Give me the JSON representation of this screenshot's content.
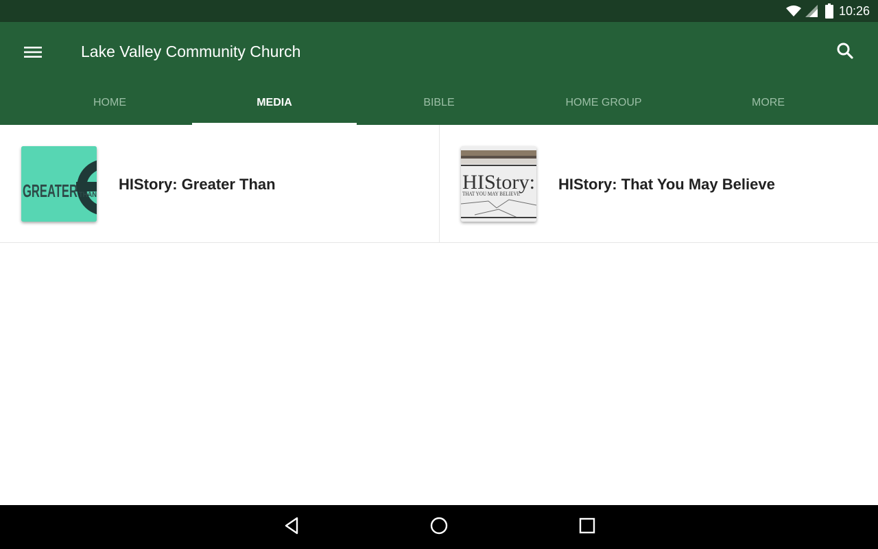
{
  "status_bar": {
    "time": "10:26",
    "icons": [
      "wifi-icon",
      "cell-signal-icon",
      "battery-icon"
    ]
  },
  "app_bar": {
    "title": "Lake Valley Community Church",
    "menu_icon": "hamburger-menu-icon",
    "search_icon": "search-icon"
  },
  "tabs": [
    {
      "label": "HOME",
      "active": false
    },
    {
      "label": "MEDIA",
      "active": true
    },
    {
      "label": "BIBLE",
      "active": false
    },
    {
      "label": "HOME GROUP",
      "active": false
    },
    {
      "label": "MORE",
      "active": false
    }
  ],
  "media_items": [
    {
      "title": "HIStory: Greater Than",
      "thumb_text_main": "GREATER",
      "thumb_text_sub": "THAN"
    },
    {
      "title": "HIStory: That You May Believe",
      "thumb_text_main": "HIStory:",
      "thumb_text_sub": "THAT YOU MAY BELIEVE"
    }
  ],
  "nav_bar": {
    "icons": [
      "back-icon",
      "home-icon",
      "recents-icon"
    ]
  },
  "colors": {
    "status_bar": "#1b3d25",
    "app_bar": "#256038",
    "tab_inactive": "#9cbfa6",
    "tab_active": "#ffffff",
    "title_text": "#212121",
    "nav_bar": "#000000"
  }
}
